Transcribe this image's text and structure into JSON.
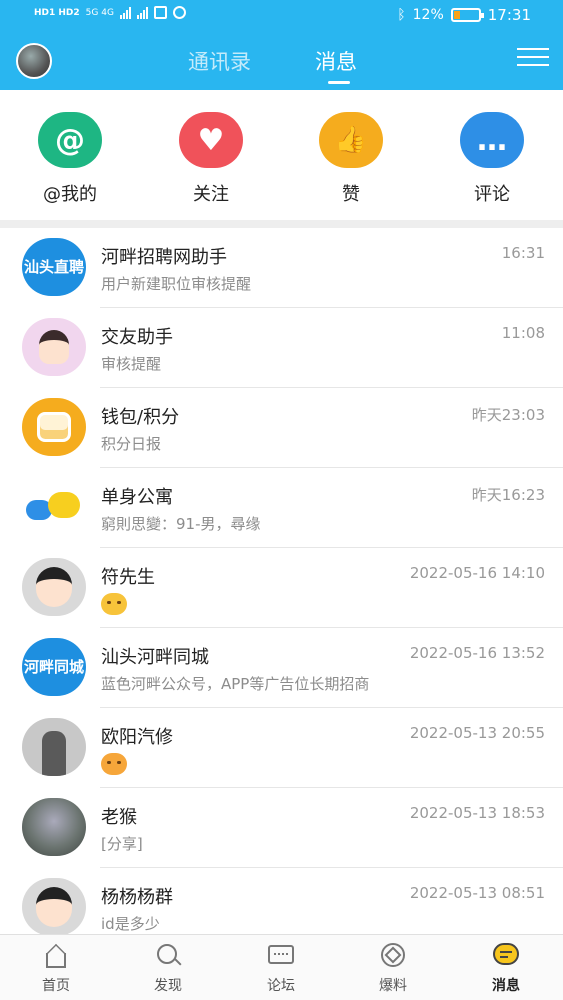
{
  "status_bar": {
    "sim_labels": "HD1 HD2",
    "network": "5G 4G",
    "battery_percent": "12%",
    "battery_level": 0.12,
    "time": "17:31"
  },
  "header": {
    "tabs": [
      {
        "label": "通讯录",
        "active": false
      },
      {
        "label": "消息",
        "active": true
      }
    ],
    "menu_icon": "menu-lines-icon"
  },
  "actions": [
    {
      "label": "@我的",
      "icon": "at-icon",
      "glyph": "@",
      "color": "#1eb683"
    },
    {
      "label": "关注",
      "icon": "heart-plus-icon",
      "glyph": "♥",
      "color": "#f0525a"
    },
    {
      "label": "赞",
      "icon": "thumbs-up-icon",
      "glyph": "👍",
      "color": "#f5ac1e"
    },
    {
      "label": "评论",
      "icon": "comment-icon",
      "glyph": "…",
      "color": "#2e8fe6"
    }
  ],
  "messages": [
    {
      "name": "河畔招聘网助手",
      "time": "16:31",
      "preview": "用户新建职位审核提醒",
      "avatar_text": "汕头直聘",
      "avatar_color": "#1e8fe0"
    },
    {
      "name": "交友助手",
      "time": "11:08",
      "preview": "审核提醒",
      "avatar_text": "",
      "avatar_color": "#f1d6ee"
    },
    {
      "name": "钱包/积分",
      "time": "昨天23:03",
      "preview": "积分日报",
      "avatar_text": "",
      "avatar_color": "#f5ac1e"
    },
    {
      "name": "单身公寓",
      "time": "昨天16:23",
      "preview": "窮則思變：91-男，尋缘",
      "avatar_text": "",
      "avatar_color": "#ffffff"
    },
    {
      "name": "符先生",
      "time": "2022-05-16 14:10",
      "preview": "",
      "avatar_text": "",
      "avatar_color": "#d9d9d9"
    },
    {
      "name": "汕头河畔同城",
      "time": "2022-05-16 13:52",
      "preview": "蓝色河畔公众号，APP等广告位长期招商",
      "avatar_text": "河畔同城",
      "avatar_color": "#1e8fe0"
    },
    {
      "name": "欧阳汽修",
      "time": "2022-05-13 20:55",
      "preview": "",
      "avatar_text": "",
      "avatar_color": "#c8c8c8"
    },
    {
      "name": "老猴",
      "time": "2022-05-13 18:53",
      "preview": "[分享]",
      "avatar_text": "",
      "avatar_color": "#7d8a86"
    },
    {
      "name": "杨杨杨群",
      "time": "2022-05-13 08:51",
      "preview": "id是多少",
      "avatar_text": "",
      "avatar_color": "#d9d9d9"
    }
  ],
  "bottom_nav": [
    {
      "label": "首页",
      "icon": "home-icon",
      "active": false
    },
    {
      "label": "发现",
      "icon": "search-icon",
      "active": false
    },
    {
      "label": "论坛",
      "icon": "forum-icon",
      "active": false
    },
    {
      "label": "爆料",
      "icon": "explore-icon",
      "active": false
    },
    {
      "label": "消息",
      "icon": "message-icon",
      "active": true
    }
  ]
}
